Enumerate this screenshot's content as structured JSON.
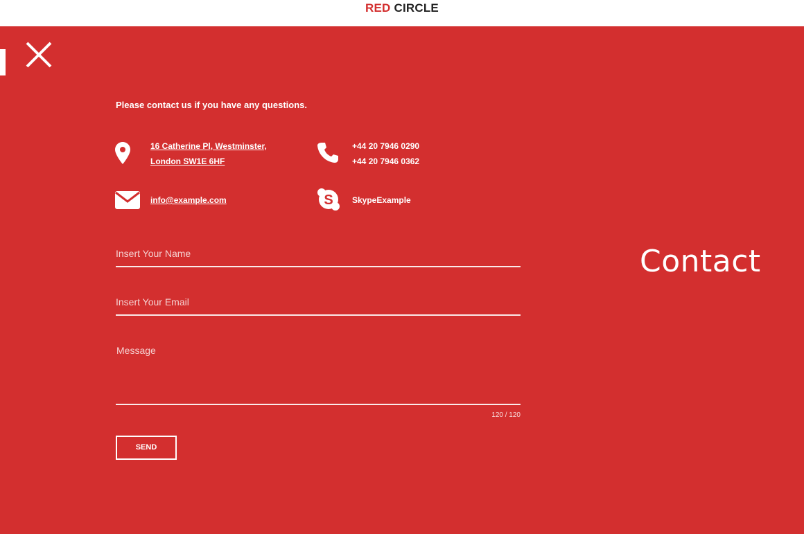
{
  "brand": {
    "first": "RED",
    "second": "CIRCLE"
  },
  "colors": {
    "accent": "#d32f2f",
    "text": "#ffffff"
  },
  "icons": {
    "close": "close-icon",
    "location": "map-pin-icon",
    "phone": "phone-icon",
    "email": "envelope-icon",
    "skype": "skype-icon"
  },
  "contact": {
    "intro": "Please contact us if you have any questions.",
    "address_line1": "16 Catherine Pl, Westminster,",
    "address_line2": "London SW1E 6HF",
    "phone1": "+44 20 7946 0290",
    "phone2": "+44 20 7946 0362",
    "email": "info@example.com",
    "skype": "SkypeExample"
  },
  "form": {
    "name_placeholder": "Insert Your Name",
    "email_placeholder": "Insert Your Email",
    "message_placeholder": "Message",
    "counter": "120 / 120",
    "send_label": "SEND"
  },
  "heading": "Contact"
}
